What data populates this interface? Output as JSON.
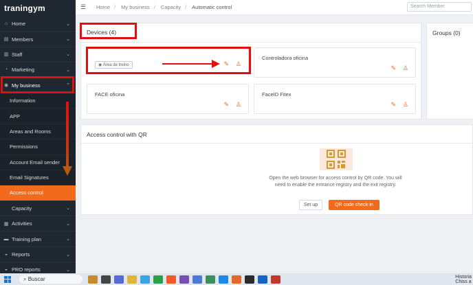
{
  "app": {
    "logo": "traningym"
  },
  "sidebar": {
    "items": [
      {
        "label": "Home",
        "icon": "home-icon",
        "glyph": "⌂"
      },
      {
        "label": "Members",
        "icon": "members-icon",
        "glyph": "▤"
      },
      {
        "label": "Staff",
        "icon": "staff-icon",
        "glyph": "▥"
      },
      {
        "label": "Marketing",
        "icon": "marketing-icon",
        "glyph": "◔"
      },
      {
        "label": "My business",
        "icon": "location-icon",
        "glyph": "◉"
      }
    ],
    "sub_items": [
      "Information",
      "APP",
      "Areas and Rooms",
      "Permissions",
      "Account Email sender",
      "Email Signatures",
      "Access control"
    ],
    "lower_items": [
      {
        "label": "Capacity",
        "icon": "",
        "glyph": ""
      },
      {
        "label": "Activities",
        "icon": "activities-icon",
        "glyph": "▦"
      },
      {
        "label": "Training plan",
        "icon": "training-icon",
        "glyph": "▬"
      },
      {
        "label": "Reports",
        "icon": "reports-icon",
        "glyph": "◒"
      },
      {
        "label": "PRO reports",
        "icon": "pro-reports-icon",
        "glyph": "◒"
      }
    ]
  },
  "topbar": {
    "breadcrumbs": [
      "Home",
      "My business",
      "Capacity",
      "Automatic control"
    ],
    "search_placeholder": "Search Member"
  },
  "devices": {
    "title": "Devices (4)",
    "cards": [
      {
        "name": "",
        "tag": "Área de treino"
      },
      {
        "name": "Controladora oficina",
        "tag": ""
      },
      {
        "name": "FACE oficina",
        "tag": ""
      },
      {
        "name": "FaceID Fitex",
        "tag": ""
      }
    ]
  },
  "groups": {
    "title": "Groups (0)"
  },
  "qr": {
    "title": "Access control with QR",
    "description": "Open the web browser for access control by QR code. You will need to enable the entrance registry and the exit registry.",
    "setup_label": "Set up",
    "checkin_label": "QR code check-in"
  },
  "taskbar": {
    "search_label": "Buscar",
    "right_label": "Historia",
    "right_sublabel": "Chiss a"
  },
  "colors": {
    "accent": "#f26a1b",
    "sidebar": "#1f2730",
    "annotation": "#e01010"
  }
}
